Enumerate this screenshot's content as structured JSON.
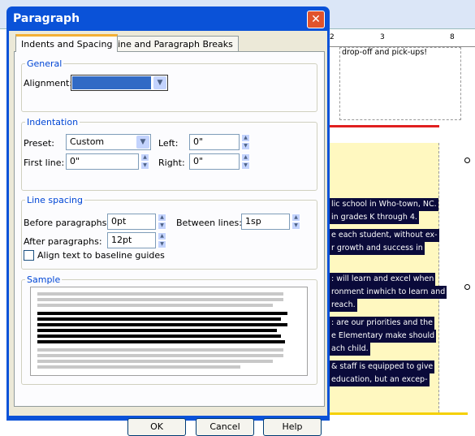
{
  "dialog": {
    "title": "Paragraph",
    "close_icon": "close-icon",
    "tabs": [
      {
        "label": "Indents and Spacing",
        "active": true
      },
      {
        "label": "Line and Paragraph Breaks",
        "active": false
      }
    ],
    "general": {
      "label": "General",
      "alignment_label": "Alignment:",
      "alignment_value": ""
    },
    "indentation": {
      "label": "Indentation",
      "preset_label": "Preset:",
      "preset_value": "Custom",
      "left_label": "Left:",
      "left_value": "0\"",
      "first_line_label": "First line:",
      "first_line_value": "0\"",
      "right_label": "Right:",
      "right_value": "0\""
    },
    "line_spacing": {
      "label": "Line spacing",
      "before_label": "Before paragraphs:",
      "before_value": "0pt",
      "between_label": "Between lines:",
      "between_value": "1sp",
      "after_label": "After paragraphs:",
      "after_value": "12pt",
      "baseline_label": "Align text to baseline guides",
      "baseline_checked": false
    },
    "sample": {
      "label": "Sample"
    },
    "buttons": {
      "ok": "OK",
      "cancel": "Cancel",
      "help": "Help"
    }
  },
  "ruler": {
    "marks": [
      "2",
      "3",
      "8"
    ]
  },
  "document": {
    "top_text": "drop-off and pick-ups!",
    "lines": [
      "lic school in Who-town, NC.",
      "in grades K through 4.",
      "e each student, without ex-",
      "r growth and success in",
      ": will learn and excel when",
      "ronment inwhich to learn and",
      "reach.",
      ": are our priorities and the",
      "e Elementary make should",
      "ach child.",
      "& staff is equipped to give",
      "education, but an excep-"
    ]
  }
}
